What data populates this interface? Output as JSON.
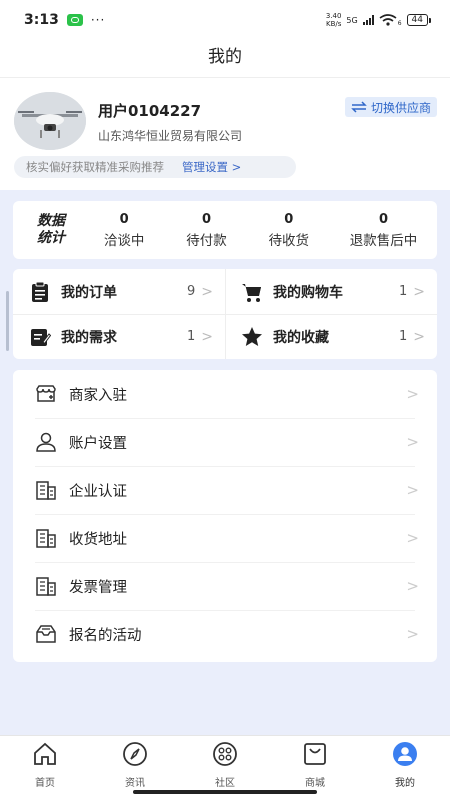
{
  "status": {
    "time": "3:13",
    "dots": "···",
    "net_speed_top": "3.40",
    "net_speed_bottom": "KB/s",
    "network": "5G",
    "wifi_sub": "6",
    "battery": "44"
  },
  "header": {
    "title": "我的"
  },
  "profile": {
    "username": "用户0104227",
    "company": "山东鸿华恒业贸易有限公司",
    "switch_label": "切换供应商",
    "pref_text": "核实偏好获取精准采购推荐",
    "pref_link": "管理设置 >"
  },
  "stats": {
    "label_line1": "数据",
    "label_line2": "统计",
    "items": [
      {
        "count": "0",
        "label": "洽谈中"
      },
      {
        "count": "0",
        "label": "待付款"
      },
      {
        "count": "0",
        "label": "待收货"
      },
      {
        "count": "0",
        "label": "退款售后中"
      }
    ]
  },
  "quick": {
    "orders": {
      "label": "我的订单",
      "count": "9"
    },
    "cart": {
      "label": "我的购物车",
      "count": "1"
    },
    "needs": {
      "label": "我的需求",
      "count": "1"
    },
    "favorites": {
      "label": "我的收藏",
      "count": "1"
    },
    "chevron": ">"
  },
  "menu": [
    {
      "label": "商家入驻",
      "icon": "shop-icon"
    },
    {
      "label": "账户设置",
      "icon": "user-icon"
    },
    {
      "label": "企业认证",
      "icon": "building-icon"
    },
    {
      "label": "收货地址",
      "icon": "building-icon"
    },
    {
      "label": "发票管理",
      "icon": "building-icon"
    },
    {
      "label": "报名的活动",
      "icon": "inbox-icon"
    }
  ],
  "menu_chevron": ">",
  "tabs": [
    {
      "label": "首页",
      "icon": "home-icon"
    },
    {
      "label": "资讯",
      "icon": "compass-icon"
    },
    {
      "label": "社区",
      "icon": "community-icon"
    },
    {
      "label": "商城",
      "icon": "bag-icon"
    },
    {
      "label": "我的",
      "icon": "profile-icon",
      "active": true
    }
  ],
  "colors": {
    "accent": "#2f67c9",
    "background": "#eaeefb",
    "active_tab": "#3b7ff0"
  }
}
